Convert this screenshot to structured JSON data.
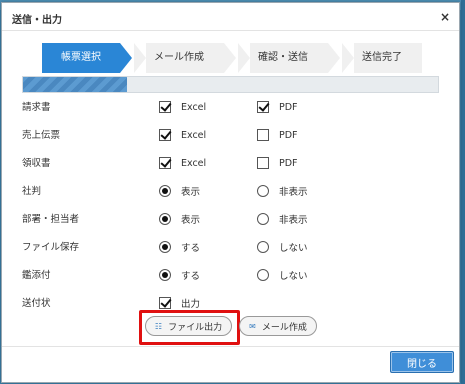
{
  "dialog": {
    "title": "送信・出力",
    "close_symbol": "×"
  },
  "steps": [
    {
      "label": "帳票選択",
      "active": true
    },
    {
      "label": "メール作成",
      "active": false
    },
    {
      "label": "確認・送信",
      "active": false
    },
    {
      "label": "送信完了",
      "active": false
    }
  ],
  "progress": {
    "fraction": 0.25
  },
  "rows": [
    {
      "label": "請求書",
      "type": "checkbox",
      "options": [
        {
          "text": "Excel",
          "checked": true
        },
        {
          "text": "PDF",
          "checked": true
        }
      ]
    },
    {
      "label": "売上伝票",
      "type": "checkbox",
      "options": [
        {
          "text": "Excel",
          "checked": true
        },
        {
          "text": "PDF",
          "checked": false
        }
      ]
    },
    {
      "label": "領収書",
      "type": "checkbox",
      "options": [
        {
          "text": "Excel",
          "checked": true
        },
        {
          "text": "PDF",
          "checked": false
        }
      ]
    },
    {
      "label": "社判",
      "type": "radio",
      "options": [
        {
          "text": "表示",
          "checked": true
        },
        {
          "text": "非表示",
          "checked": false
        }
      ]
    },
    {
      "label": "部署・担当者",
      "type": "radio",
      "options": [
        {
          "text": "表示",
          "checked": true
        },
        {
          "text": "非表示",
          "checked": false
        }
      ]
    },
    {
      "label": "ファイル保存",
      "type": "radio",
      "options": [
        {
          "text": "する",
          "checked": true
        },
        {
          "text": "しない",
          "checked": false
        }
      ]
    },
    {
      "label": "鑑添付",
      "type": "radio",
      "options": [
        {
          "text": "する",
          "checked": true
        },
        {
          "text": "しない",
          "checked": false
        }
      ]
    },
    {
      "label": "送付状",
      "type": "checkbox",
      "options": [
        {
          "text": "出力",
          "checked": true
        }
      ]
    }
  ],
  "buttons": {
    "file_output": "ファイル出力",
    "mail_create": "メール作成",
    "close": "閉じる"
  },
  "colors": {
    "accent": "#2a86d6",
    "highlight": "#e01010"
  }
}
